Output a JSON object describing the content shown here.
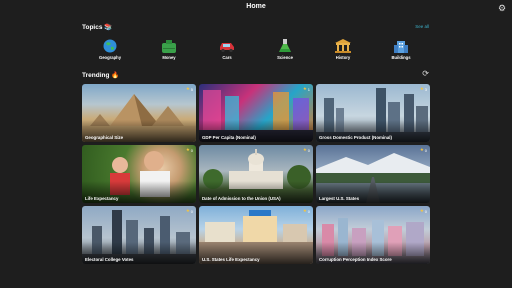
{
  "header": {
    "title": "Home",
    "settings_icon": "gear-icon"
  },
  "topics": {
    "title": "Topics 📚",
    "see_all": "See all",
    "items": [
      {
        "label": "Geography",
        "icon": "globe-icon"
      },
      {
        "label": "Money",
        "icon": "money-bag-icon"
      },
      {
        "label": "Cars",
        "icon": "car-icon"
      },
      {
        "label": "Science",
        "icon": "flask-icon"
      },
      {
        "label": "History",
        "icon": "columns-icon"
      },
      {
        "label": "Buildings",
        "icon": "building-icon"
      }
    ]
  },
  "trending": {
    "title": "Trending 🔥",
    "refresh_icon": "refresh-icon",
    "cards": [
      {
        "label": "Geographical Size",
        "count": "5"
      },
      {
        "label": "GDP Per Capita (Nominal)",
        "count": "1"
      },
      {
        "label": "Gross Domestic Product (Nominal)",
        "count": "3"
      },
      {
        "label": "Life Expectancy",
        "count": "0"
      },
      {
        "label": "Date of Admission to the Union (USA)",
        "count": "0"
      },
      {
        "label": "Largest U.S. States",
        "count": "0"
      },
      {
        "label": "Electoral College Votes",
        "count": "0"
      },
      {
        "label": "U.S. States Life Expectancy",
        "count": "0"
      },
      {
        "label": "Corruption Perception Index Score",
        "count": "0"
      }
    ]
  }
}
